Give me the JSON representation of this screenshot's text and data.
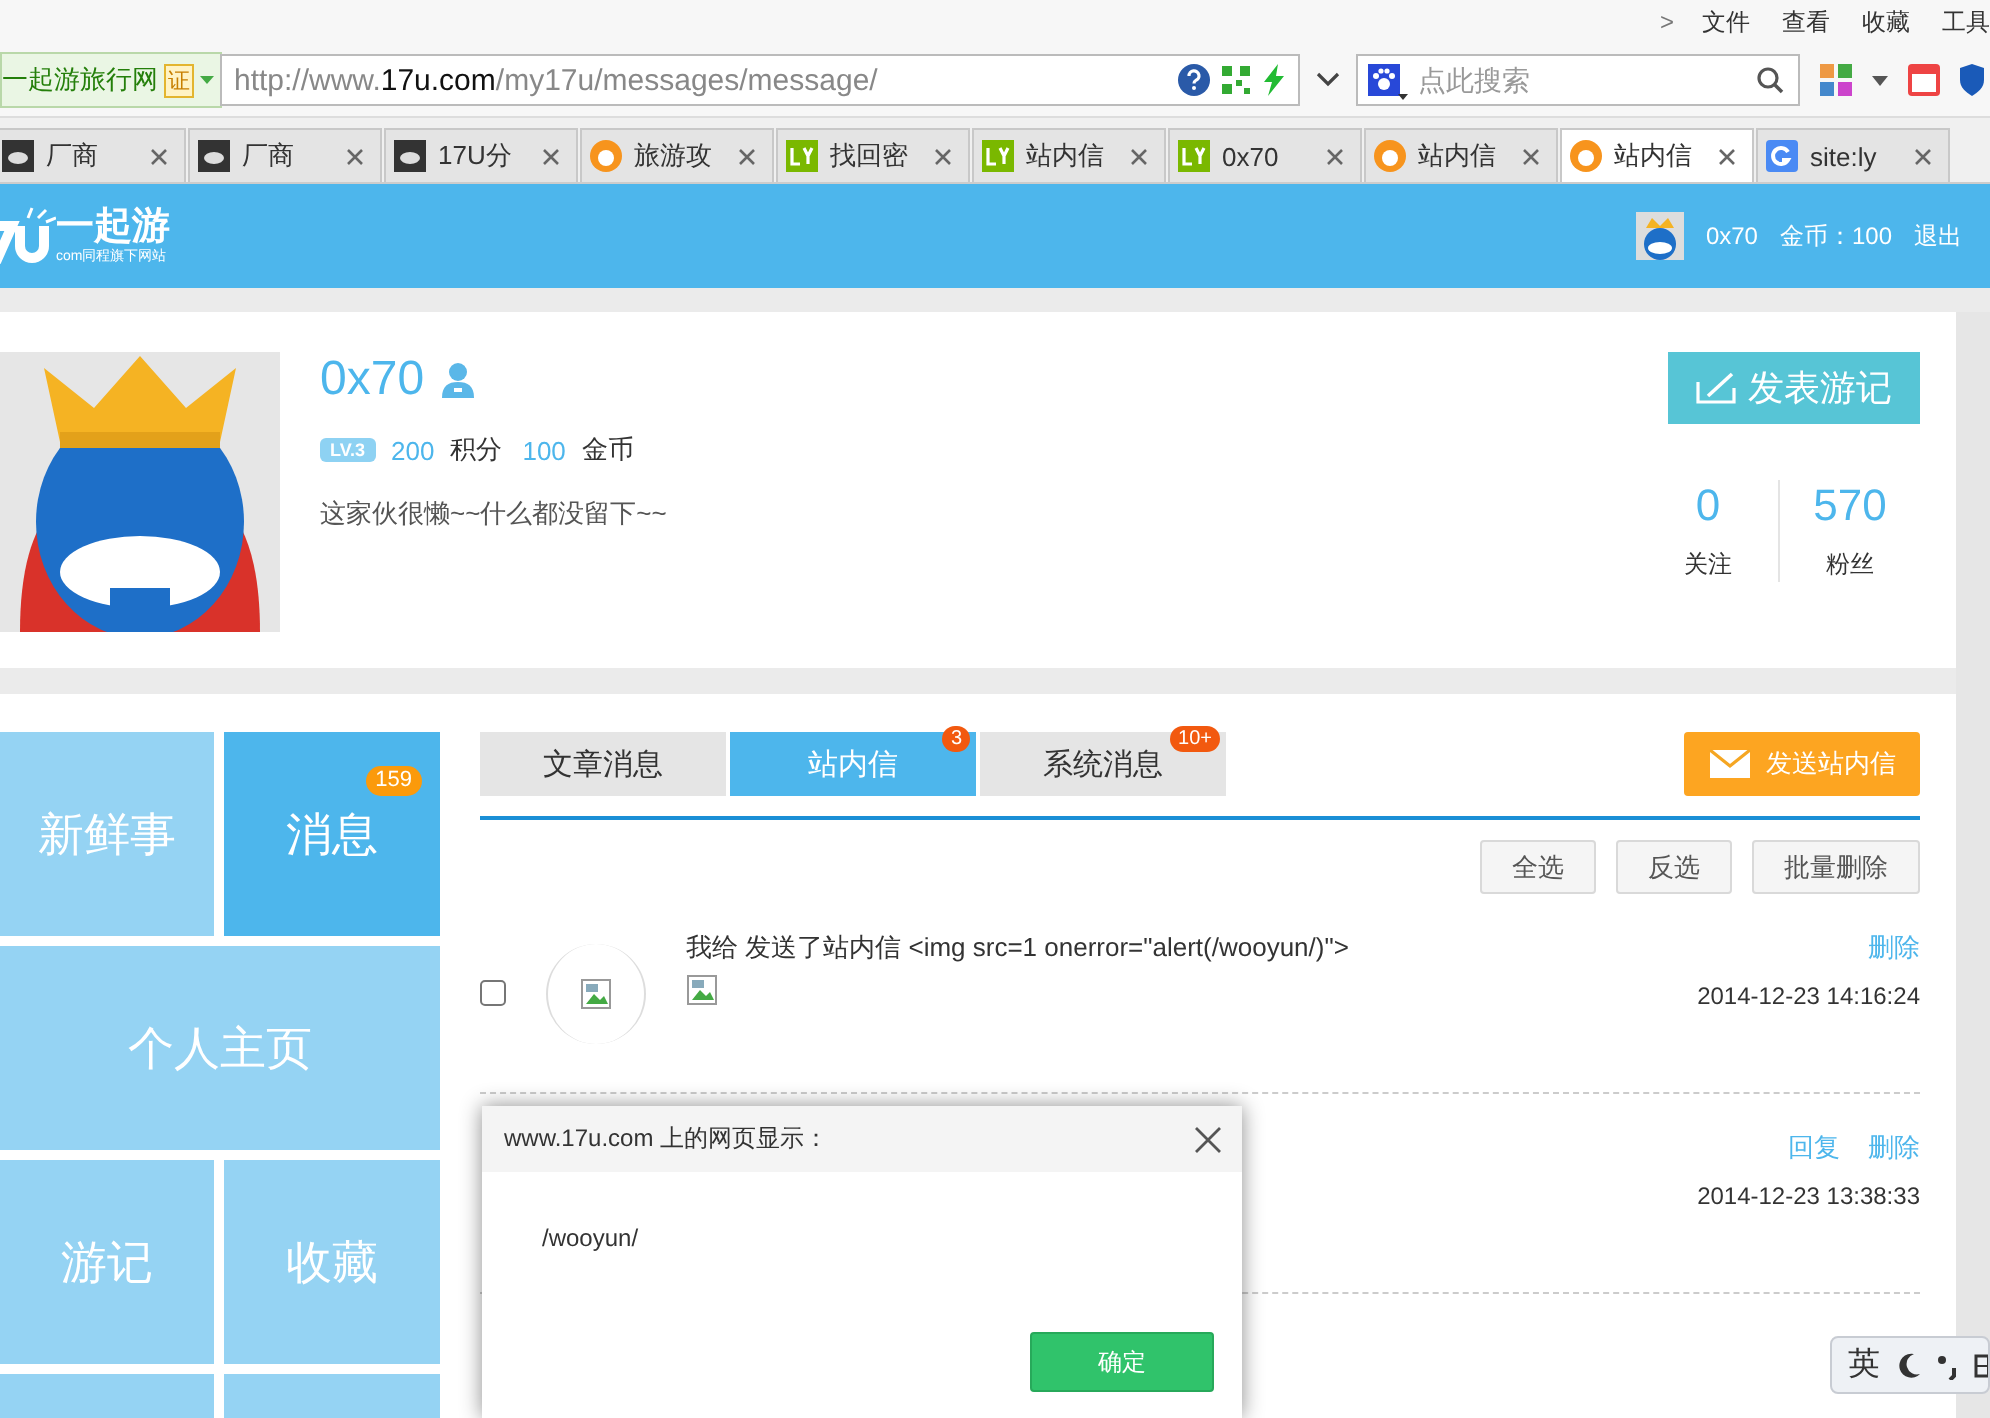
{
  "browser": {
    "menu": [
      ">",
      "文件",
      "查看",
      "收藏",
      "工具"
    ],
    "address_bar": {
      "site_label": "一起游旅行网",
      "cert_badge": "证",
      "url": "http://www.**17u.com**/my17u/messages/message/"
    },
    "search": {
      "placeholder": "点此搜索"
    },
    "tabs": [
      {
        "label": "厂商",
        "kind": "cloud",
        "selected": false
      },
      {
        "label": "厂商",
        "kind": "cloud",
        "selected": false
      },
      {
        "label": "17U分",
        "kind": "cloud",
        "selected": false
      },
      {
        "label": "旅游攻",
        "kind": "fox",
        "selected": false
      },
      {
        "label": "找回密",
        "kind": "ly",
        "selected": false
      },
      {
        "label": "站内信",
        "kind": "ly",
        "selected": false
      },
      {
        "label": "0x70",
        "kind": "ly",
        "selected": false
      },
      {
        "label": "站内信",
        "kind": "fox",
        "selected": false
      },
      {
        "label": "站内信",
        "kind": "fox",
        "selected": true
      },
      {
        "label": "site:ly",
        "kind": "g",
        "selected": false
      }
    ]
  },
  "header": {
    "logo_text": "一起游",
    "logo_sub": "com同程旗下网站",
    "user": "0x70",
    "coins": "金币：100",
    "logout": "退出"
  },
  "profile": {
    "name": "0x70",
    "level": "LV.3",
    "points": "200",
    "points_label": "积分",
    "gold": "100",
    "gold_label": "金币",
    "bio": "这家伙很懒~~什么都没留下~~",
    "post_button": "发表游记",
    "stats": [
      {
        "value": "0",
        "label": "关注"
      },
      {
        "value": "570",
        "label": "粉丝"
      }
    ]
  },
  "sidebar": [
    {
      "label": "新鲜事",
      "selected": false,
      "wide": false
    },
    {
      "label": "消息",
      "selected": true,
      "wide": false,
      "badge": "159"
    },
    {
      "label": "个人主页",
      "selected": false,
      "wide": true
    },
    {
      "label": "游记",
      "selected": false,
      "wide": false
    },
    {
      "label": "收藏",
      "selected": false,
      "wide": false
    }
  ],
  "message_tabs": [
    {
      "label": "文章消息",
      "selected": false
    },
    {
      "label": "站内信",
      "selected": true,
      "badge": "3"
    },
    {
      "label": "系统消息",
      "selected": false,
      "badge": "10+"
    }
  ],
  "send_button": "发送站内信",
  "actions": [
    "全选",
    "反选",
    "批量删除"
  ],
  "messages": [
    {
      "text": "我给 发送了站内信 <img src=1 onerror=\"alert(/wooyun/)\">",
      "date": "2014-12-23 14:16:24",
      "actions": [
        "删除"
      ],
      "checked": false
    },
    {
      "date": "2014-12-23 13:38:33",
      "actions": [
        "回复",
        "删除"
      ]
    }
  ],
  "dialog": {
    "title": "www.17u.com 上的网页显示：",
    "message": "/wooyun/",
    "ok": "确定"
  },
  "ime": {
    "label": "英"
  }
}
